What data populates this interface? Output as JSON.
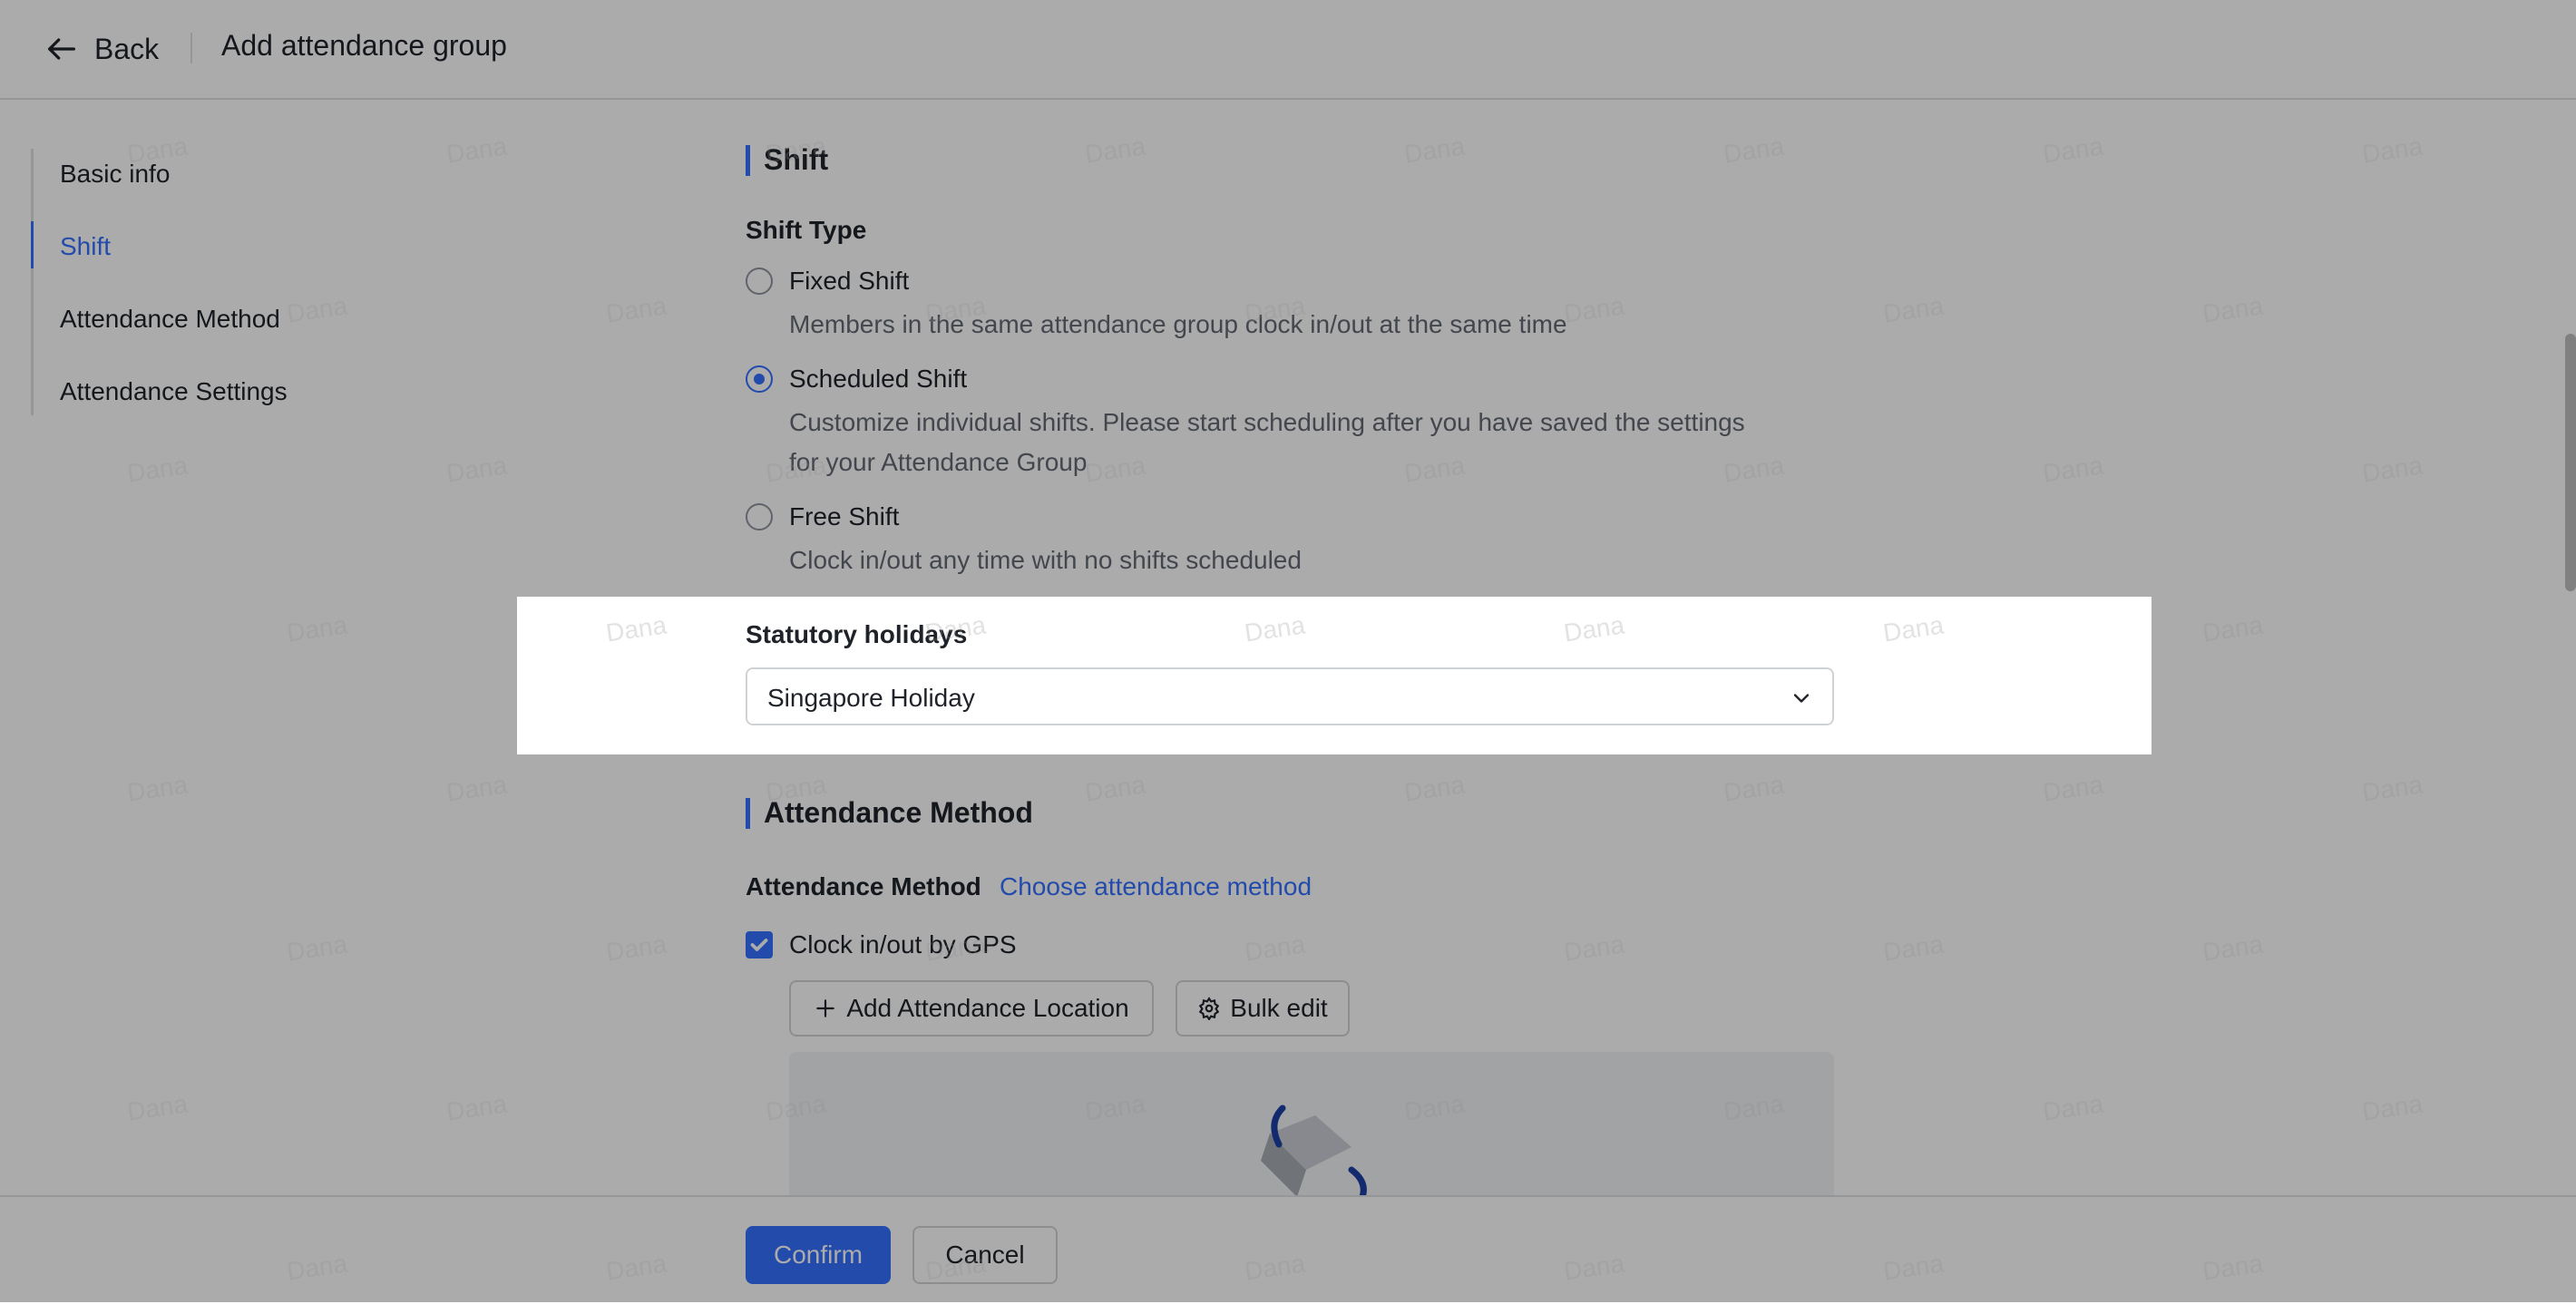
{
  "header": {
    "back_label": "Back",
    "title": "Add attendance group"
  },
  "sidebar": {
    "items": [
      {
        "label": "Basic info",
        "active": false
      },
      {
        "label": "Shift",
        "active": true
      },
      {
        "label": "Attendance Method",
        "active": false
      },
      {
        "label": "Attendance Settings",
        "active": false
      }
    ]
  },
  "shift": {
    "section_title": "Shift",
    "type_label": "Shift Type",
    "options": [
      {
        "label": "Fixed Shift",
        "desc_line1": "Members in the same attendance group clock in/out at the same time",
        "desc_line2": "",
        "checked": false
      },
      {
        "label": "Scheduled Shift",
        "desc_line1": "Customize individual shifts. Please start scheduling after you have saved the settings",
        "desc_line2": "for your Attendance Group",
        "checked": true
      },
      {
        "label": "Free Shift",
        "desc_line1": "Clock in/out any time with no shifts scheduled",
        "desc_line2": "",
        "checked": false
      }
    ],
    "holidays_label": "Statutory holidays",
    "holidays_value": "Singapore Holiday"
  },
  "attendance_method": {
    "section_title": "Attendance Method",
    "method_label": "Attendance Method",
    "choose_link": "Choose attendance method",
    "gps_label": "Clock in/out by GPS",
    "gps_checked": true,
    "add_location_label": "Add Attendance Location",
    "bulk_edit_label": "Bulk edit"
  },
  "footer": {
    "confirm_label": "Confirm",
    "cancel_label": "Cancel"
  },
  "watermark_text": "Dana",
  "colors": {
    "accent": "#3370ff",
    "text": "#1f2329",
    "secondary_text": "#646a73",
    "border": "#d0d3d6"
  }
}
